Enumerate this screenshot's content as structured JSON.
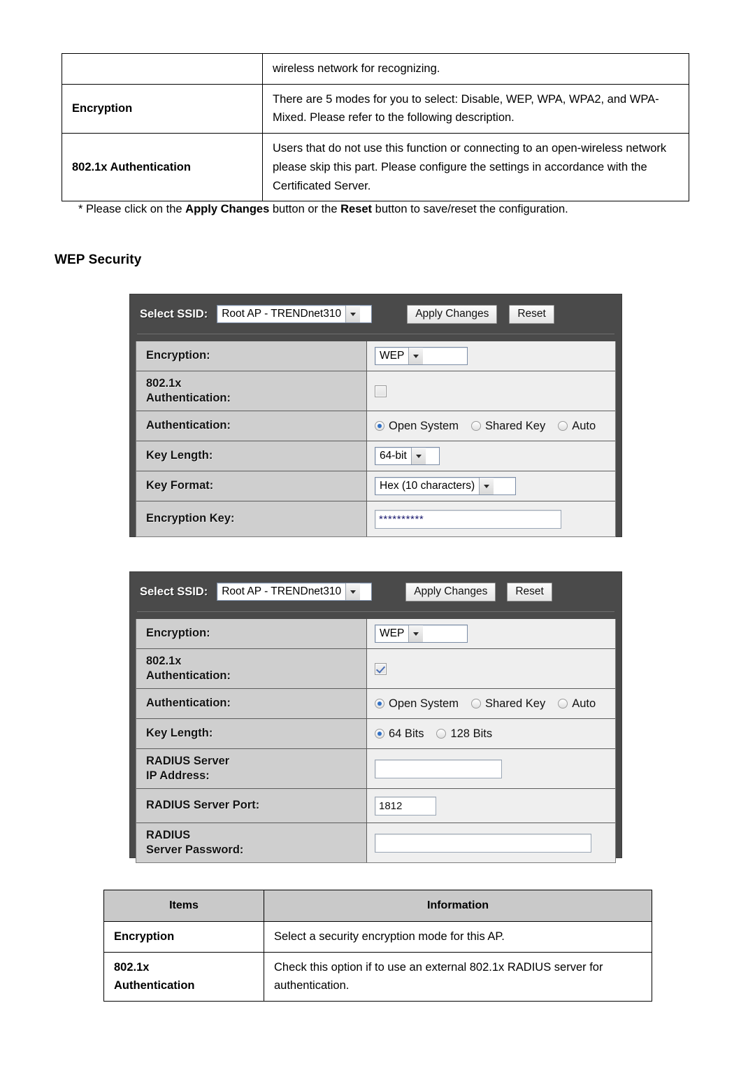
{
  "top_table": {
    "rows": [
      {
        "item": "",
        "description": "wireless network for recognizing."
      },
      {
        "item": "Encryption",
        "description": "There are 5 modes for you to select: Disable, WEP, WPA, WPA2, and WPA-Mixed. Please refer to the following description."
      },
      {
        "item": "802.1x Authentication",
        "description": "Users that do not use this function or connecting to an open-wireless network please skip this part. Please configure the settings in accordance with the Certificated Server."
      }
    ]
  },
  "note": {
    "prefix": "* Please click on the ",
    "bold1": "Apply Changes",
    "mid": " button or the ",
    "bold2": "Reset",
    "suffix": " button to save/reset the configuration."
  },
  "heading": "WEP Security",
  "panel1": {
    "topbar": {
      "select_ssid_label": "Select SSID:",
      "ssid_value": "Root AP - TRENDnet310",
      "apply_label": "Apply Changes",
      "reset_label": "Reset"
    },
    "rows": {
      "encryption_label": "Encryption:",
      "encryption_value": "WEP",
      "dot1x_label_line1": "802.1x",
      "dot1x_label_line2": "Authentication:",
      "dot1x_checked": "false",
      "auth_label": "Authentication:",
      "auth_options": [
        "Open System",
        "Shared Key",
        "Auto"
      ],
      "auth_selected": "Open System",
      "keylen_label": "Key Length:",
      "keylen_value": "64-bit",
      "keyformat_label": "Key Format:",
      "keyformat_value": "Hex (10 characters)",
      "enckey_label": "Encryption Key:",
      "enckey_value": "**********"
    }
  },
  "panel2": {
    "topbar": {
      "select_ssid_label": "Select SSID:",
      "ssid_value": "Root AP - TRENDnet310",
      "apply_label": "Apply Changes",
      "reset_label": "Reset"
    },
    "rows": {
      "encryption_label": "Encryption:",
      "encryption_value": "WEP",
      "dot1x_label_line1": "802.1x",
      "dot1x_label_line2": "Authentication:",
      "dot1x_checked": "true",
      "auth_label": "Authentication:",
      "auth_options": [
        "Open System",
        "Shared Key",
        "Auto"
      ],
      "auth_selected": "Open System",
      "keylen_label": "Key Length:",
      "keylen_options": [
        "64 Bits",
        "128 Bits"
      ],
      "keylen_selected": "64 Bits",
      "radius_ip_label_line1": "RADIUS Server",
      "radius_ip_label_line2": "IP Address:",
      "radius_ip_value": "",
      "radius_port_label": "RADIUS Server Port:",
      "radius_port_value": "1812",
      "radius_pass_label_line1": "RADIUS",
      "radius_pass_label_line2": "Server Password:",
      "radius_pass_value": ""
    }
  },
  "bottom_table": {
    "headers": [
      "Items",
      "Information"
    ],
    "rows": [
      {
        "item": "Encryption",
        "item_line2": "",
        "info": "Select a security encryption mode for this AP."
      },
      {
        "item": "802.1x",
        "item_line2": "Authentication",
        "info": "Check this option if to use an external 802.1x RADIUS server for authentication."
      }
    ]
  }
}
